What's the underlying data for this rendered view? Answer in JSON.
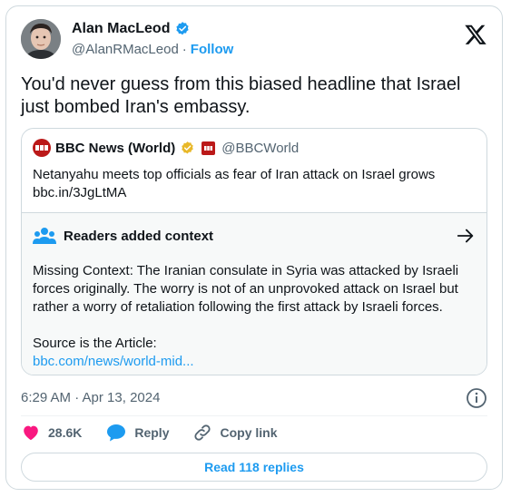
{
  "author": {
    "name": "Alan MacLeod",
    "handle": "@AlanRMacLeod",
    "separator": "·",
    "follow_label": "Follow",
    "verified_icon": "verified-badge-icon",
    "accent": "#1d9bf0"
  },
  "platform_logo": "x-logo-icon",
  "tweet_text": "You'd never guess from this biased headline that Israel just bombed Iran's embassy.",
  "quote": {
    "name": "BBC News (World)",
    "handle": "@BBCWorld",
    "text": "Netanyahu meets top officials as fear of Iran attack on Israel grows",
    "link": "bbc.in/3JgLtMA",
    "avatar_text": "BBC",
    "brand_color": "#bb1919"
  },
  "context": {
    "title": "Readers added context",
    "body": "Missing Context: The Iranian consulate in Syria was attacked by Israeli forces originally. The worry is not of an unprovoked attack on Israel but rather a worry of retaliation following the first attack by Israeli forces.",
    "source_label": "Source is the Article:",
    "source_link": "bbc.com/news/world-mid..."
  },
  "timestamp": "6:29 AM · Apr 13, 2024",
  "actions": {
    "likes": "28.6K",
    "reply_label": "Reply",
    "copy_label": "Copy link",
    "like_color": "#f91880"
  },
  "read_replies_label": "Read 118 replies"
}
